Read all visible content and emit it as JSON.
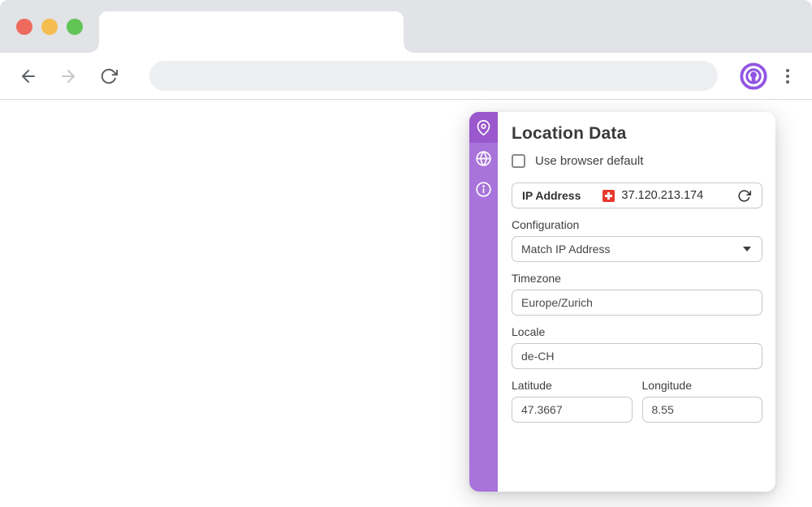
{
  "browser": {
    "tab_title": "",
    "address_bar": {
      "value": ""
    },
    "traffic_lights": {
      "close": "close",
      "minimize": "minimize",
      "maximize": "maximize"
    },
    "theme": {
      "chrome_bg": "#e1e3e6",
      "accent_purple": "#9155e2"
    }
  },
  "popup": {
    "title": "Location Data",
    "sidebar": {
      "items": [
        {
          "id": "location",
          "icon": "location-pin-icon",
          "active": true
        },
        {
          "id": "browser",
          "icon": "globe-icon",
          "active": false
        },
        {
          "id": "info",
          "icon": "info-icon",
          "active": false
        }
      ],
      "bg": "#a873da",
      "active_bg": "#9a58cc"
    },
    "use_browser_default": {
      "label": "Use browser default",
      "checked": false
    },
    "ip": {
      "label": "IP Address",
      "value": "37.120.213.174",
      "flag": "swiss-flag-icon"
    },
    "fields": {
      "configuration": {
        "label": "Configuration",
        "value": "Match IP Address"
      },
      "timezone": {
        "label": "Timezone",
        "value": "Europe/Zurich"
      },
      "locale": {
        "label": "Locale",
        "value": "de-CH"
      },
      "latitude": {
        "label": "Latitude",
        "value": "47.3667"
      },
      "longitude": {
        "label": "Longitude",
        "value": "8.55"
      }
    }
  }
}
